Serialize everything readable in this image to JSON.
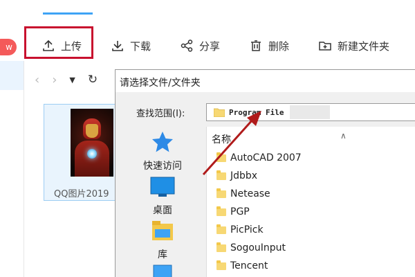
{
  "app": {
    "new_badge": "w",
    "toolbar": {
      "upload": "上传",
      "download": "下载",
      "share": "分享",
      "delete": "删除",
      "new_folder": "新建文件夹"
    },
    "file_card": {
      "name": "QQ图片2019"
    }
  },
  "dialog": {
    "title": "请选择文件/文件夹",
    "look_in_label": "查找范围(I):",
    "look_in_value": "Program File",
    "sidebar": [
      {
        "label": "快速访问",
        "icon": "star-icon"
      },
      {
        "label": "桌面",
        "icon": "desktop-icon"
      },
      {
        "label": "库",
        "icon": "library-icon"
      }
    ],
    "column_name": "名称",
    "folders": [
      "AutoCAD 2007",
      "Jdbbx",
      "Netease",
      "PGP",
      "PicPick",
      "SogouInput",
      "Tencent"
    ]
  },
  "colors": {
    "highlight_red": "#c8102e",
    "accent_blue": "#3ea3f5",
    "folder_yellow": "#f7d874"
  }
}
